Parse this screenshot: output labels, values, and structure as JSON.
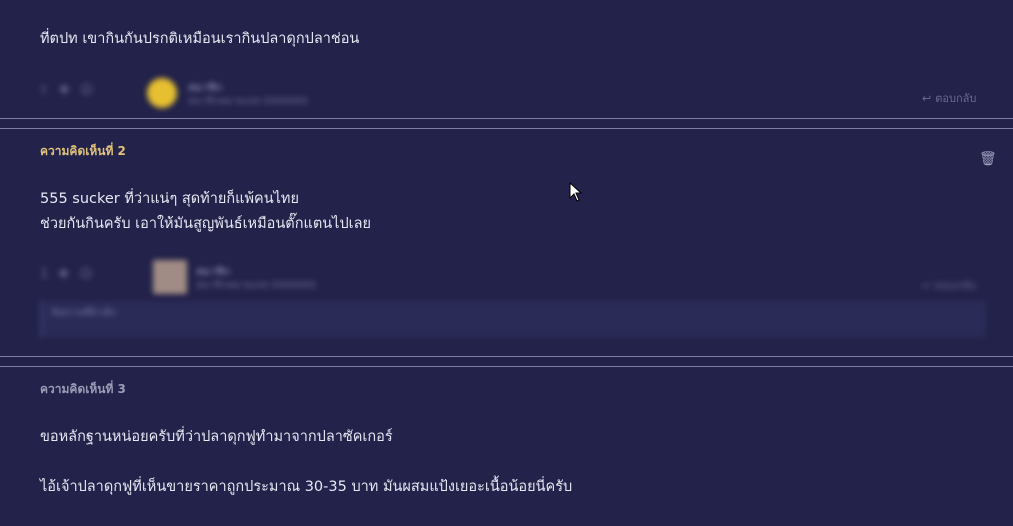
{
  "comments": [
    {
      "text_lines": [
        "ที่ตปท เขากินกันปรกติเหมือนเรากินปลาดุกปลาช่อน"
      ],
      "user": {
        "name": "สมาชิก",
        "meta": "สมาชิกหมายเลข 0000000"
      },
      "vote_count": "",
      "reply_label": "ตอบกลับ"
    },
    {
      "label": "ความคิดเห็นที่ 2",
      "text_lines": [
        "555 sucker ที่ว่าแน่ๆ สุดท้ายก็แพ้คนไทย",
        "ช่วยกันกินครับ เอาให้มันสูญพันธ์เหมือนตั๊กแตนไปเลย"
      ],
      "user": {
        "name": "สมาชิก",
        "meta": "สมาชิกหมายเลข 0000000"
      },
      "vote_count": "1",
      "reply_label": "ตอบกลับ",
      "quote_text": "ข้อความที่อ้างอิง"
    },
    {
      "label": "ความคิดเห็นที่ 3",
      "text_lines": [
        "ขอหลักฐานหน่อยครับที่ว่าปลาดุกฟูทำมาจากปลาซัคเกอร์",
        "ไอ้เจ้าปลาดุกฟูที่เห็นขายราคาถูกประมาณ 30-35 บาท มันผสมแป้งเยอะเนื้อน้อยนี่ครับ"
      ]
    }
  ],
  "colors": {
    "background": "#22224a",
    "label_highlight": "#e0c27a",
    "label_muted": "#9c9cb8",
    "divider": "#7d7da6"
  }
}
